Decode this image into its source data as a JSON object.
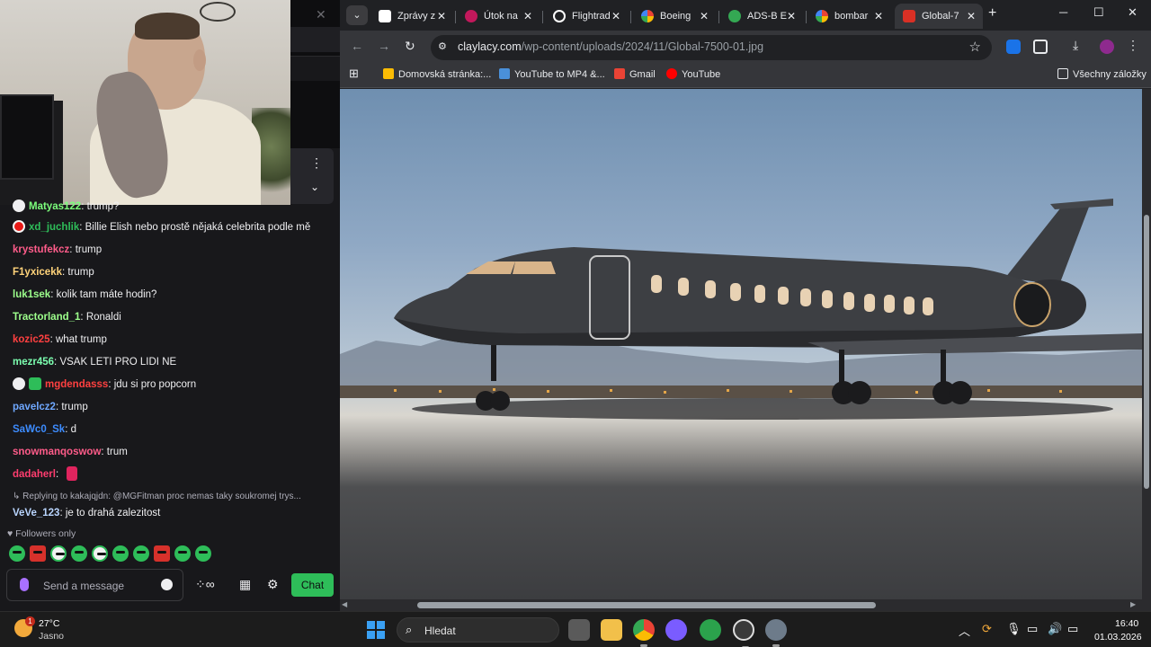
{
  "chat": {
    "partial_top_message": {
      "user": "Matyas122",
      "text": "trump?"
    },
    "messages": [
      {
        "user": "xd_juchlik",
        "color": "#2ebd59",
        "text": "Billie Elish nebo prostě nějaká celebrita podle mě"
      },
      {
        "user": "krystufekcz",
        "color": "#ff5c8a",
        "text": "trump"
      },
      {
        "user": "F1yxicekk",
        "color": "#ffd37a",
        "text": "trump"
      },
      {
        "user": "luk1sek",
        "color": "#9dff8c",
        "text": "kolik tam máte hodin?"
      },
      {
        "user": "Tractorland_1",
        "color": "#9dff8c",
        "text": "Ronaldi"
      },
      {
        "user": "kozic25",
        "color": "#ff4040",
        "text": "what trump"
      },
      {
        "user": "mezr456",
        "color": "#7cffb0",
        "text": "VSAK LETI PRO LIDI NE"
      },
      {
        "user": "mgdendasss",
        "color": "#ff4040",
        "text": "jdu si pro popcorn"
      },
      {
        "user": "pavelcz2",
        "color": "#6fa8ff",
        "text": "trump"
      },
      {
        "user": "SaWc0_Sk",
        "color": "#3d8cff",
        "text": "d"
      },
      {
        "user": "snowmanqoswow",
        "color": "#ff5c8a",
        "text": "trum"
      },
      {
        "user": "dadaherl",
        "color": "#ff3d6f",
        "text": ""
      }
    ],
    "reply_context": "Replying to kakajqjdn: @MGFitman proc nemas taky soukromej trys...",
    "reply_message": {
      "user": "VeVe_123",
      "color": "#b9d5ff",
      "text": "je to drahá zalezitost"
    },
    "followers_only": "Followers only",
    "message_placeholder": "Send a message",
    "chat_button": "Chat"
  },
  "browser": {
    "tabs": [
      {
        "title": "Zprávy z",
        "fav_color": "#ffffff"
      },
      {
        "title": "Útok na",
        "fav_color": "#c2185b"
      },
      {
        "title": "Flightrad",
        "fav_color": "#ffffff"
      },
      {
        "title": "Boeing",
        "fav_color": "#4285f4"
      },
      {
        "title": "ADS-B E",
        "fav_color": "#34a853"
      },
      {
        "title": "bombar",
        "fav_color": "#4285f4"
      },
      {
        "title": "Global-7",
        "fav_color": "#d93025",
        "active": true
      }
    ],
    "url_host": "claylacy.com",
    "url_path": "/wp-content/uploads/2024/11/Global-7500-01.jpg",
    "bookmarks": [
      {
        "label": "Domovská stránka:...",
        "color": "#fbbc04"
      },
      {
        "label": "YouTube to MP4 &...",
        "color": "#4a90d9"
      },
      {
        "label": "Gmail",
        "color": "#ea4335"
      },
      {
        "label": "YouTube",
        "color": "#ff0000"
      }
    ],
    "all_bookmarks": "Všechny záložky"
  },
  "taskbar": {
    "weather_temp": "27°C",
    "weather_cond": "Jasno",
    "weather_badge": "1",
    "search_label": "Hledat",
    "time": "16:40",
    "date": "01.03.2026"
  }
}
